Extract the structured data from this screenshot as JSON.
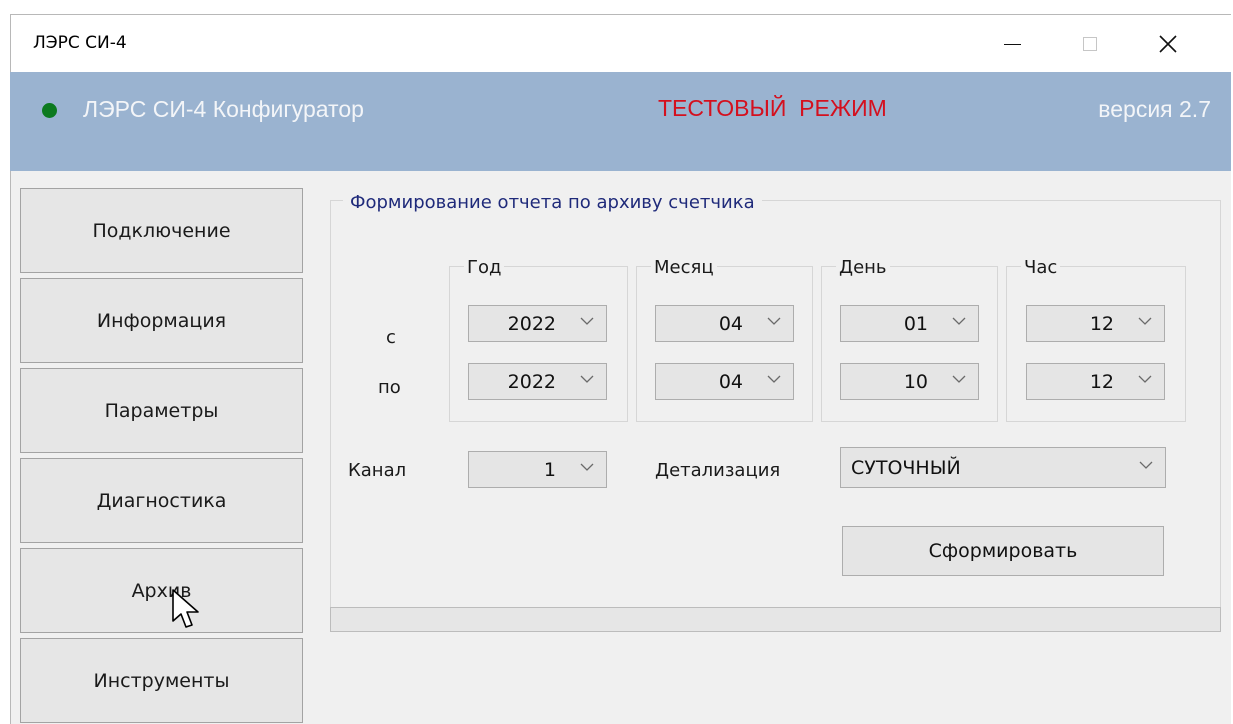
{
  "window": {
    "title": "ЛЭРС СИ-4",
    "controls": {
      "minimize": "minimize-icon",
      "maximize": "maximize-icon",
      "close": "close-icon"
    }
  },
  "banner": {
    "app_name": "ЛЭРС СИ-4 Конфигуратор",
    "mode": "ТЕСТОВЫЙ  РЕЖИМ",
    "version": "версия 2.7",
    "status_led_color": "#0c7a1f",
    "background_color": "#9ab3d0",
    "mode_color": "#d4101e"
  },
  "sidebar": {
    "items": [
      {
        "label": "Подключение"
      },
      {
        "label": "Информация"
      },
      {
        "label": "Параметры"
      },
      {
        "label": "Диагностика"
      },
      {
        "label": "Архив"
      },
      {
        "label": "Инструменты"
      }
    ]
  },
  "report": {
    "title": "Формирование отчета по архиву счетчика",
    "row_labels": {
      "from": "с",
      "to": "по"
    },
    "columns": [
      {
        "label": "Год",
        "from": "2022",
        "to": "2022"
      },
      {
        "label": "Месяц",
        "from": "04",
        "to": "04"
      },
      {
        "label": "День",
        "from": "01",
        "to": "10"
      },
      {
        "label": "Час",
        "from": "12",
        "to": "12"
      }
    ],
    "channel": {
      "label": "Канал",
      "value": "1"
    },
    "detail": {
      "label": "Детализация",
      "value": "СУТОЧНЫЙ"
    },
    "generate_label": "Сформировать",
    "progress": 0
  }
}
